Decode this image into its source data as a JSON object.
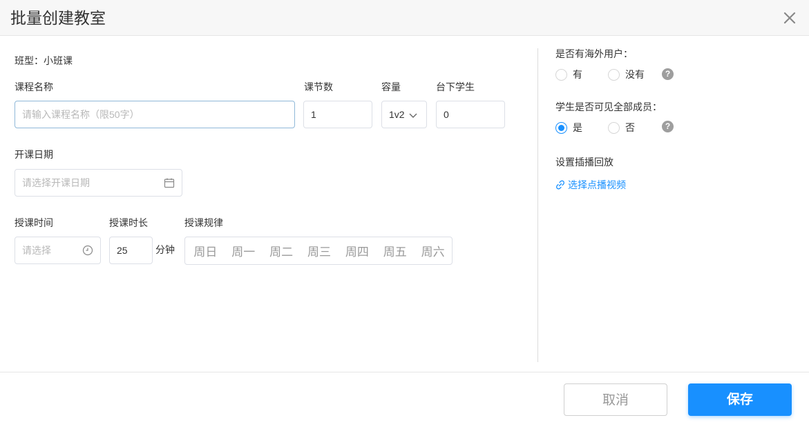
{
  "dialog": {
    "title": "批量创建教室"
  },
  "form": {
    "class_type": "班型：小班课",
    "course_name": {
      "label": "课程名称",
      "placeholder": "请输入课程名称（限50字）"
    },
    "lesson_count": {
      "label": "课节数",
      "value": "1"
    },
    "capacity": {
      "label": "容量",
      "value": "1v2"
    },
    "audience": {
      "label": "台下学生",
      "value": "0"
    },
    "start_date": {
      "label": "开课日期",
      "placeholder": "请选择开课日期"
    },
    "class_time": {
      "label": "授课时间",
      "placeholder": "请选择"
    },
    "duration": {
      "label": "授课时长",
      "value": "25",
      "unit": "分钟"
    },
    "schedule": {
      "label": "授课规律",
      "days": [
        "周日",
        "周一",
        "周二",
        "周三",
        "周四",
        "周五",
        "周六"
      ]
    }
  },
  "side": {
    "overseas": {
      "label": "是否有海外用户：",
      "options": [
        "有",
        "没有"
      ],
      "selected": ""
    },
    "visible": {
      "label": "学生是否可见全部成员：",
      "options": [
        "是",
        "否"
      ],
      "selected": "是"
    },
    "playback": {
      "label": "设置插播回放",
      "link": "选择点播视频"
    }
  },
  "footer": {
    "cancel": "取消",
    "save": "保存"
  },
  "colors": {
    "primary": "#1890ff",
    "help_icon": "#9e9e9e"
  }
}
